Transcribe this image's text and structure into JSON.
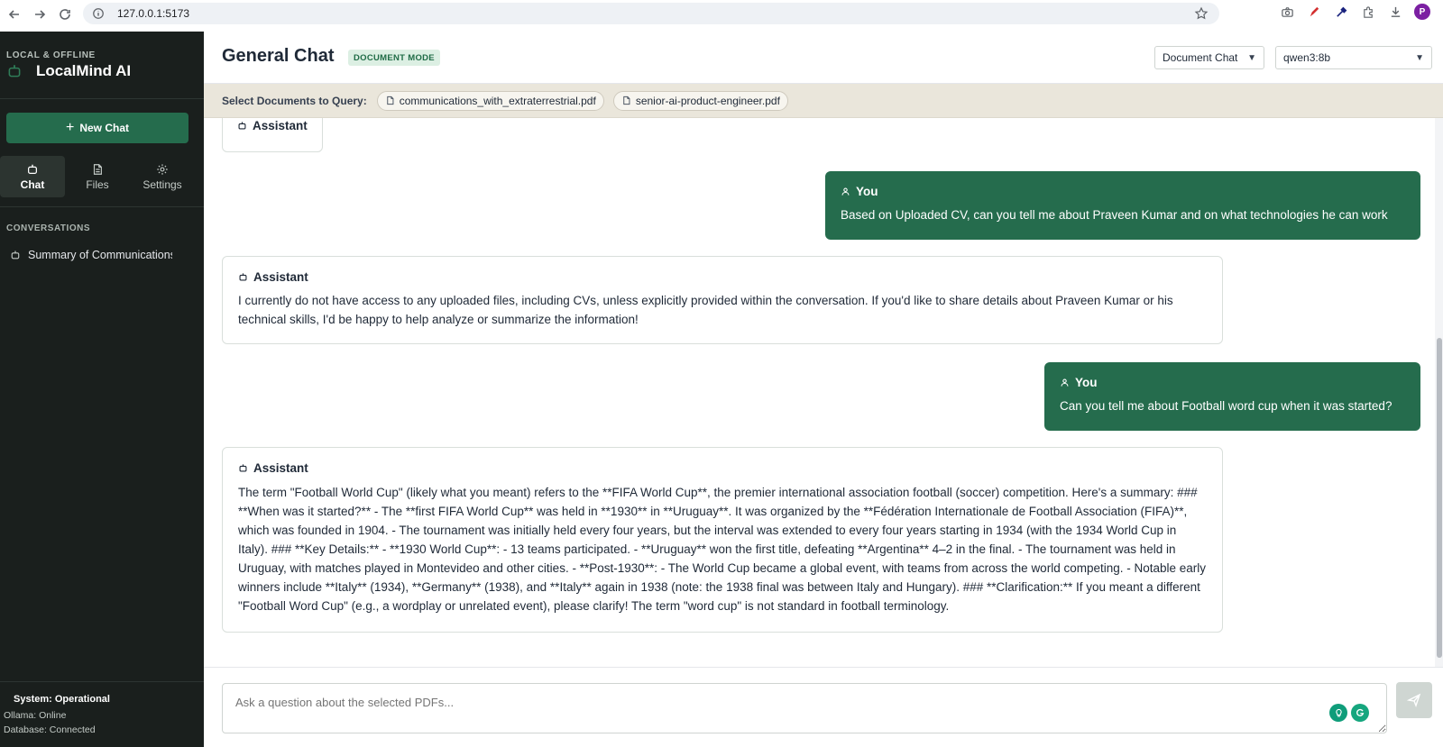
{
  "browser": {
    "url": "127.0.0.1:5173",
    "profile_initial": "P"
  },
  "sidebar": {
    "brand_sub": "LOCAL & OFFLINE",
    "brand_title": "LocalMind AI",
    "new_chat_label": "New Chat",
    "tabs": [
      {
        "label": "Chat",
        "icon": "bot-icon",
        "active": true
      },
      {
        "label": "Files",
        "icon": "file-icon",
        "active": false
      },
      {
        "label": "Settings",
        "icon": "gear-icon",
        "active": false
      }
    ],
    "conversations_heading": "CONVERSATIONS",
    "conversations": [
      {
        "title": "Summary of Communications"
      }
    ],
    "system_status": "System: Operational",
    "ollama_status": "Ollama: Online",
    "database_status": "Database: Connected"
  },
  "header": {
    "title": "General Chat",
    "mode_badge": "DOCUMENT MODE",
    "mode_select": "Document Chat",
    "model_select": "qwen3:8b"
  },
  "documents": {
    "label": "Select Documents to Query:",
    "files": [
      "communications_with_extraterrestrial.pdf",
      "senior-ai-product-engineer.pdf"
    ]
  },
  "messages": [
    {
      "role": "Assistant",
      "text": ""
    },
    {
      "role": "You",
      "text": "Based on Uploaded CV, can you tell me about Praveen Kumar and on what technologies he can work"
    },
    {
      "role": "Assistant",
      "text": "I currently do not have access to any uploaded files, including CVs, unless explicitly provided within the conversation. If you'd like to share details about Praveen Kumar or his technical skills, I'd be happy to help analyze or summarize the information!"
    },
    {
      "role": "You",
      "text": "Can you tell me about Football word cup when it was started?"
    },
    {
      "role": "Assistant",
      "text": "The term \"Football World Cup\" (likely what you meant) refers to the **FIFA World Cup**, the premier international association football (soccer) competition. Here's a summary: ### **When was it started?** - The **first FIFA World Cup** was held in **1930** in **Uruguay**. It was organized by the **Fédération Internationale de Football Association (FIFA)**, which was founded in 1904. - The tournament was initially held every four years, but the interval was extended to every four years starting in 1934 (with the 1934 World Cup in Italy). ### **Key Details:** - **1930 World Cup**: - 13 teams participated. - **Uruguay** won the first title, defeating **Argentina** 4–2 in the final. - The tournament was held in Uruguay, with matches played in Montevideo and other cities. - **Post-1930**: - The World Cup became a global event, with teams from across the world competing. - Notable early winners include **Italy** (1934), **Germany** (1938), and **Italy** again in 1938 (note: the 1938 final was between Italy and Hungary). ### **Clarification:** If you meant a different \"Football Word Cup\" (e.g., a wordplay or unrelated event), please clarify! The term \"word cup\" is not standard in football terminology."
    }
  ],
  "input": {
    "placeholder": "Ask a question about the selected PDFs..."
  },
  "colors": {
    "accent": "#256c4d",
    "sidebar_bg": "#1a1f1d",
    "doc_bar_bg": "#eae6db"
  }
}
